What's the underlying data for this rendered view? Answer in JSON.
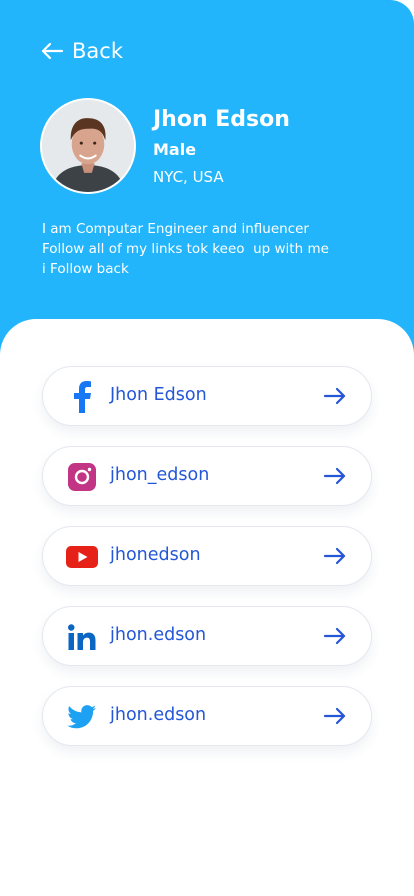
{
  "nav": {
    "back_label": "Back"
  },
  "profile": {
    "name": "Jhon Edson",
    "gender": "Male",
    "location": "NYC, USA",
    "bio": [
      "I am Computar Engineer and influencer",
      "Follow all of my links tok keeo  up with me",
      "i Follow back"
    ]
  },
  "links": [
    {
      "platform": "facebook",
      "icon": "facebook-icon",
      "label": "Jhon Edson",
      "color": "#1877f2"
    },
    {
      "platform": "instagram",
      "icon": "instagram-icon",
      "label": "jhon_edson",
      "color": "#c13584"
    },
    {
      "platform": "youtube",
      "icon": "youtube-icon",
      "label": "jhonedson",
      "color": "#e62117"
    },
    {
      "platform": "linkedin",
      "icon": "linkedin-icon",
      "label": "jhon.edson",
      "color": "#0a66c2"
    },
    {
      "platform": "twitter",
      "icon": "twitter-icon",
      "label": "jhon.edson",
      "color": "#1da1f2"
    }
  ],
  "colors": {
    "header_bg": "#22b5fb",
    "link_text": "#2357d8"
  }
}
